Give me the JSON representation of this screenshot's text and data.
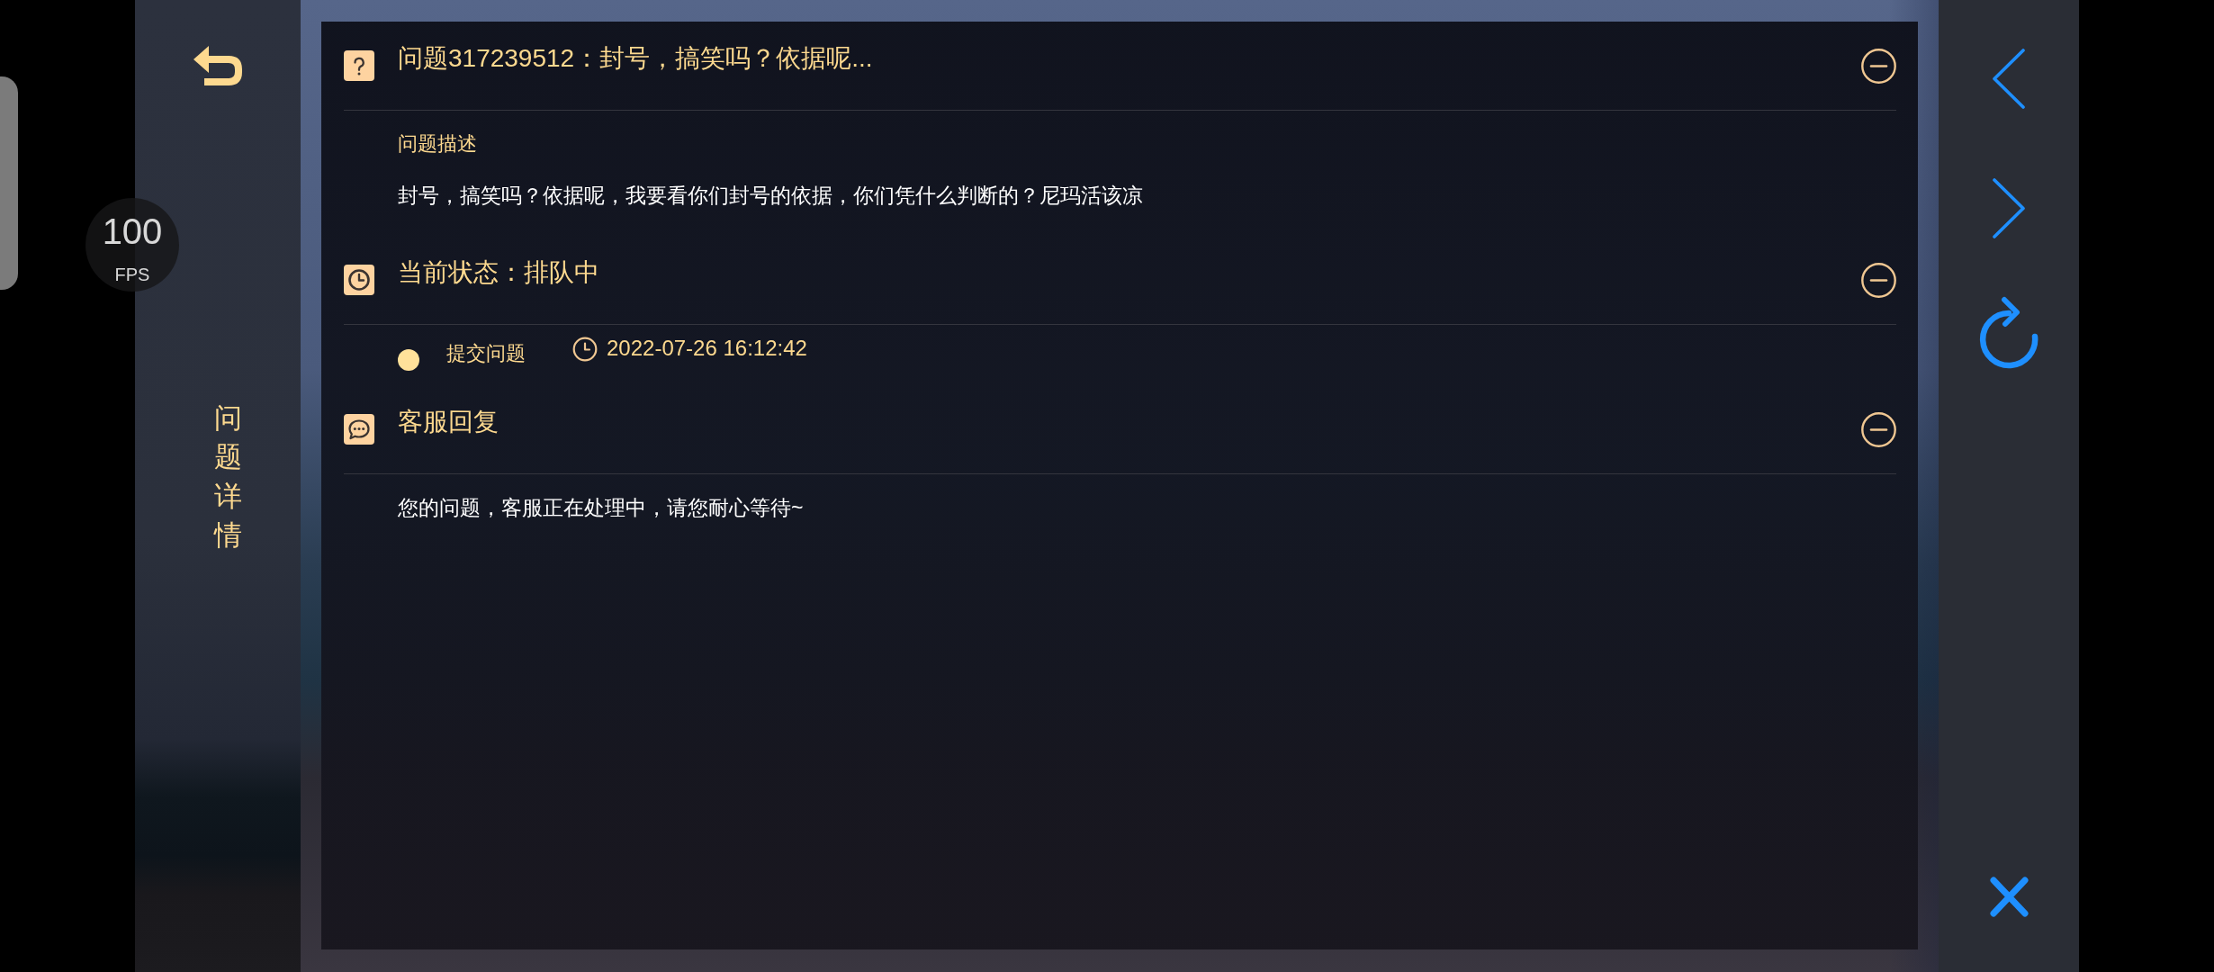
{
  "fps": {
    "value": "100",
    "unit": "FPS"
  },
  "sidebar": {
    "title": "问题详情"
  },
  "sections": [
    {
      "kind": "question",
      "title": "问题317239512：封号，搞笑吗？依据呢...",
      "expanded": true,
      "label": "问题描述",
      "text": "封号，搞笑吗？依据呢，我要看你们封号的依据，你们凭什么判断的？尼玛活该凉"
    },
    {
      "kind": "status",
      "title": "当前状态：排队中",
      "expanded": true,
      "timeline": [
        {
          "event": "提交问题",
          "time": "2022-07-26 16:12:42"
        }
      ]
    },
    {
      "kind": "reply",
      "title": "客服回复",
      "expanded": true,
      "text": "您的问题，客服正在处理中，请您耐心等待~"
    }
  ]
}
